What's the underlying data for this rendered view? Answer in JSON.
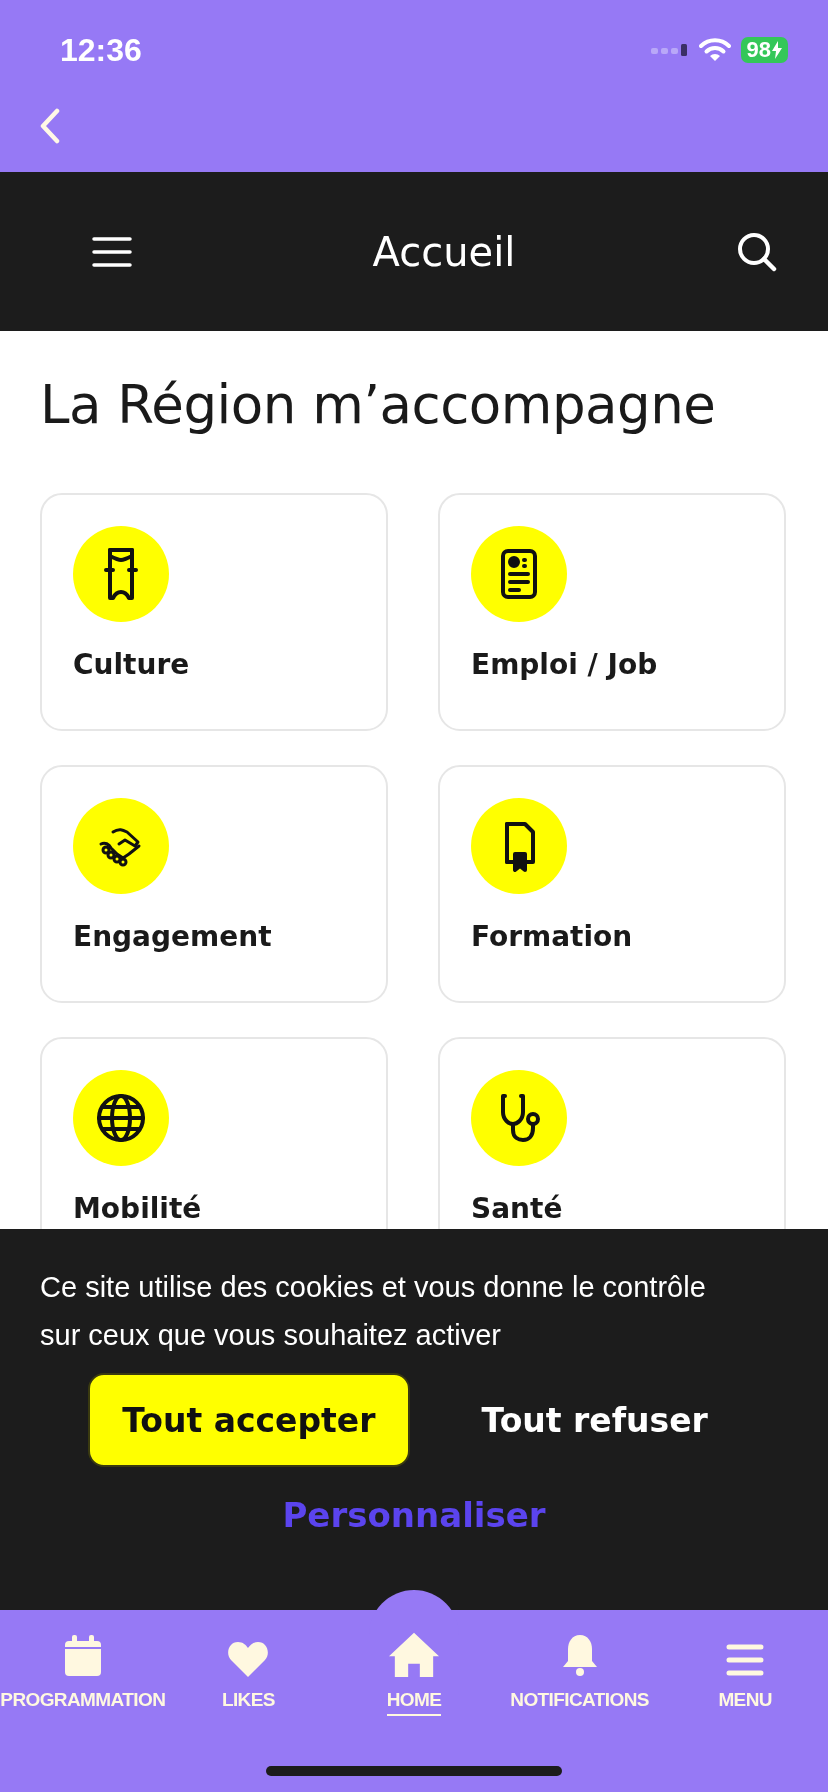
{
  "status_bar": {
    "time": "12:36",
    "battery": "98"
  },
  "header": {
    "title": "Accueil"
  },
  "heading": "La Région m’accompagne",
  "cards": [
    {
      "label": "Culture",
      "kind": "ticket"
    },
    {
      "label": "Emploi / Job",
      "kind": "id-card"
    },
    {
      "label": "Engagement",
      "kind": "handshake"
    },
    {
      "label": "Formation",
      "kind": "certificate"
    },
    {
      "label": "Mobilité",
      "kind": "globe"
    },
    {
      "label": "Santé",
      "kind": "stethoscope"
    }
  ],
  "cookie_banner": {
    "message": "Ce site utilise des cookies et vous donne le contrôle sur ceux que vous souhaitez activer",
    "buttons": [
      {
        "label": "Tout accepter",
        "kind": "primary"
      },
      {
        "label": "Tout refuser",
        "kind": "plain"
      }
    ],
    "link": "Personnaliser"
  },
  "bottom_nav": [
    {
      "label": "PROGRAMMATION",
      "kind": "calendar",
      "selected": false
    },
    {
      "label": "LIKES",
      "kind": "heart",
      "selected": false
    },
    {
      "label": "HOME",
      "kind": "home",
      "selected": true
    },
    {
      "label": "NOTIFICATIONS",
      "kind": "bell",
      "selected": false
    },
    {
      "label": "MENU",
      "kind": "menu",
      "selected": false
    }
  ]
}
